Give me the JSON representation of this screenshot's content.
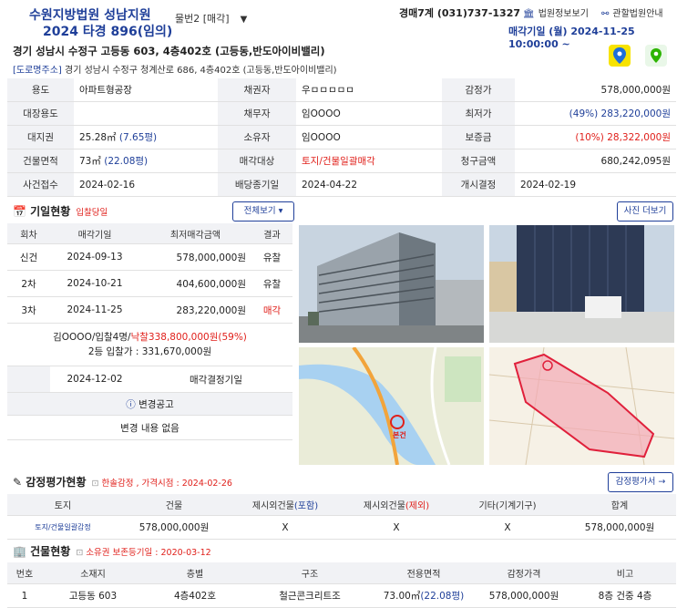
{
  "header": {
    "court_name": "수원지방법원 성남지원",
    "case_number": "2024 타경 896(임의)",
    "item_select": "물번2 [매각]",
    "dept_contact": "경매7계 (031)737-1327",
    "court_info_link": "법원정보보기",
    "jurisdiction_link": "관할법원안내",
    "sale_date": "매각기일 (월) 2024-11-25 10:00:00 ~"
  },
  "property": {
    "address": "경기 성남시 수정구 고등동 603, 4층402호 (고등동,반도아이비밸리)",
    "road_tag": "[도로명주소]",
    "road_address": "경기 성남시 수정구 청계산로 686, 4층402호 (고등동,반도아이비밸리)"
  },
  "info": {
    "rows": [
      [
        {
          "l": "용도",
          "v": "아파트형공장"
        },
        {
          "l": "채권자",
          "v": "우ㅁㅁㅁㅁㅁ"
        },
        {
          "l": "감정가",
          "v": "578,000,000원"
        }
      ],
      [
        {
          "l": "대장용도",
          "v": ""
        },
        {
          "l": "채무자",
          "v": "임OOOO"
        },
        {
          "l": "최저가",
          "v": "(49%) 283,220,000원"
        }
      ],
      [
        {
          "l": "대지권",
          "v": "25.28㎡",
          "v2": "(7.65평)"
        },
        {
          "l": "소유자",
          "v": "임OOOO"
        },
        {
          "l": "보증금",
          "v": "(10%) 28,322,000원"
        }
      ],
      [
        {
          "l": "건물면적",
          "v": "73㎡",
          "v2": "(22.08평)"
        },
        {
          "l": "매각대상",
          "v": "토지/건물일괄매각"
        },
        {
          "l": "청구금액",
          "v": "680,242,095원"
        }
      ],
      [
        {
          "l": "사건접수",
          "v": "2024-02-16"
        },
        {
          "l": "배당종기일",
          "v": "2024-04-22"
        },
        {
          "l": "개시결정",
          "v": "2024-02-19"
        }
      ]
    ]
  },
  "history": {
    "title": "기일현황",
    "subtitle": "입찰당일",
    "view_all": "전체보기",
    "headers": [
      "회차",
      "매각기일",
      "최저매각금액",
      "결과"
    ],
    "rows": [
      {
        "round": "신건",
        "date": "2024-09-13",
        "price": "578,000,000원",
        "result": "유찰"
      },
      {
        "round": "2차",
        "date": "2024-10-21",
        "price": "404,600,000원",
        "result": "유찰"
      },
      {
        "round": "3차",
        "date": "2024-11-25",
        "price": "283,220,000원",
        "result": "매각"
      }
    ],
    "winner_prefix": "김OOOO/입찰4명/",
    "winner_price": "낙찰338,800,000원(59%)",
    "second_bid": "2등 입찰가 : 331,670,000원",
    "decision_date": "2024-12-02",
    "decision_label": "매각결정기일",
    "notice_title": "변경공고",
    "notice_body": "변경 내용 없음"
  },
  "photos": {
    "more_button": "사진 더보기",
    "map_label": "본건"
  },
  "appraisal": {
    "title": "감정평가현황",
    "subtitle": "한솔감정 , 가격시점 : 2024-02-26",
    "doc_button": "감정평가서",
    "headers": [
      "토지",
      "건물",
      "제시외건물",
      "(포함)",
      "제시외건물",
      "(제외)",
      "기타(기계기구)",
      "합계"
    ],
    "row": [
      "토지/건물일괄감정",
      "578,000,000원",
      "X",
      "X",
      "X",
      "578,000,000원"
    ]
  },
  "building": {
    "title": "건물현황",
    "subtitle": "소유권 보존등기일 : 2020-03-12",
    "headers": [
      "번호",
      "소재지",
      "층별",
      "구조",
      "전용면적",
      "감정가격",
      "비고"
    ],
    "row": {
      "no": "1",
      "loc": "고등동 603",
      "floor": "4층402호",
      "struct": "철근콘크리트조",
      "area": "73.00㎡",
      "area_py": "(22.08평)",
      "price": "578,000,000원",
      "note": "8층 건중 4층"
    }
  }
}
